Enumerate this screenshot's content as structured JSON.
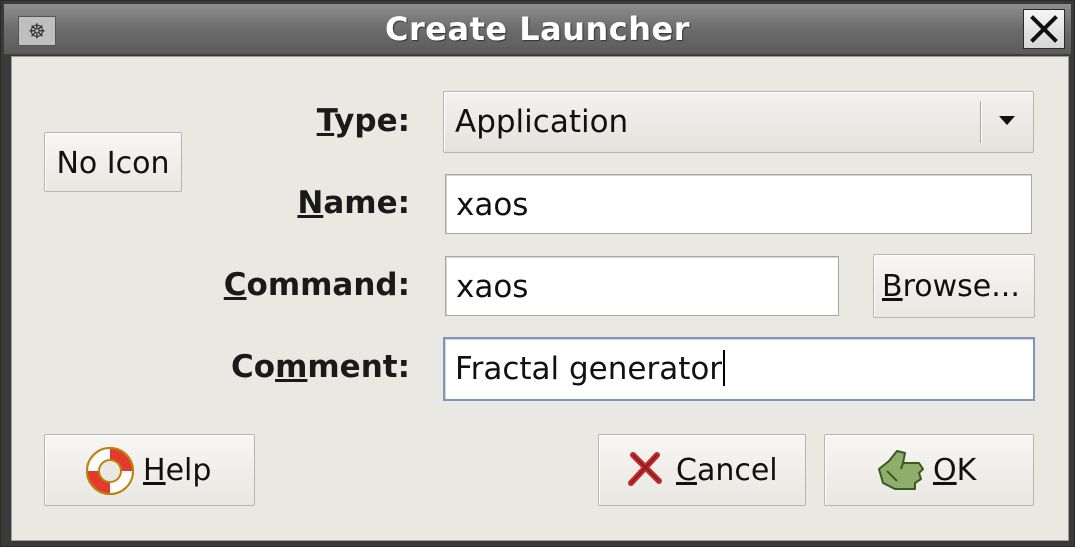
{
  "window": {
    "title": "Create Launcher",
    "app_icon_glyph": "☸"
  },
  "icons": {
    "app": "gnome-foot-icon",
    "close": "close-icon",
    "dropdown": "chevron-down-icon",
    "help": "lifebuoy-icon",
    "cancel": "cross-icon",
    "ok": "thumbs-up-icon"
  },
  "icon_button": {
    "label": "No Icon"
  },
  "form": {
    "type": {
      "label_mnemonic": "T",
      "label_rest": "ype:",
      "value": "Application"
    },
    "name": {
      "label_mnemonic": "N",
      "label_rest": "ame:",
      "value": "xaos"
    },
    "command": {
      "label_mnemonic": "C",
      "label_rest": "ommand:",
      "value": "xaos",
      "browse_mnemonic": "B",
      "browse_rest": "rowse..."
    },
    "comment": {
      "label_pre": "Co",
      "label_mnemonic": "m",
      "label_rest": "ment:",
      "value": "Fractal generator"
    }
  },
  "buttons": {
    "help": {
      "mnemonic": "H",
      "rest": "elp"
    },
    "cancel": {
      "mnemonic": "C",
      "rest": "ancel"
    },
    "ok": {
      "mnemonic": "O",
      "rest": "K"
    }
  },
  "colors": {
    "dialog_bg": "#eae8e3",
    "focus_border": "#7b96bf",
    "titlebar": "#6c6c6c"
  }
}
